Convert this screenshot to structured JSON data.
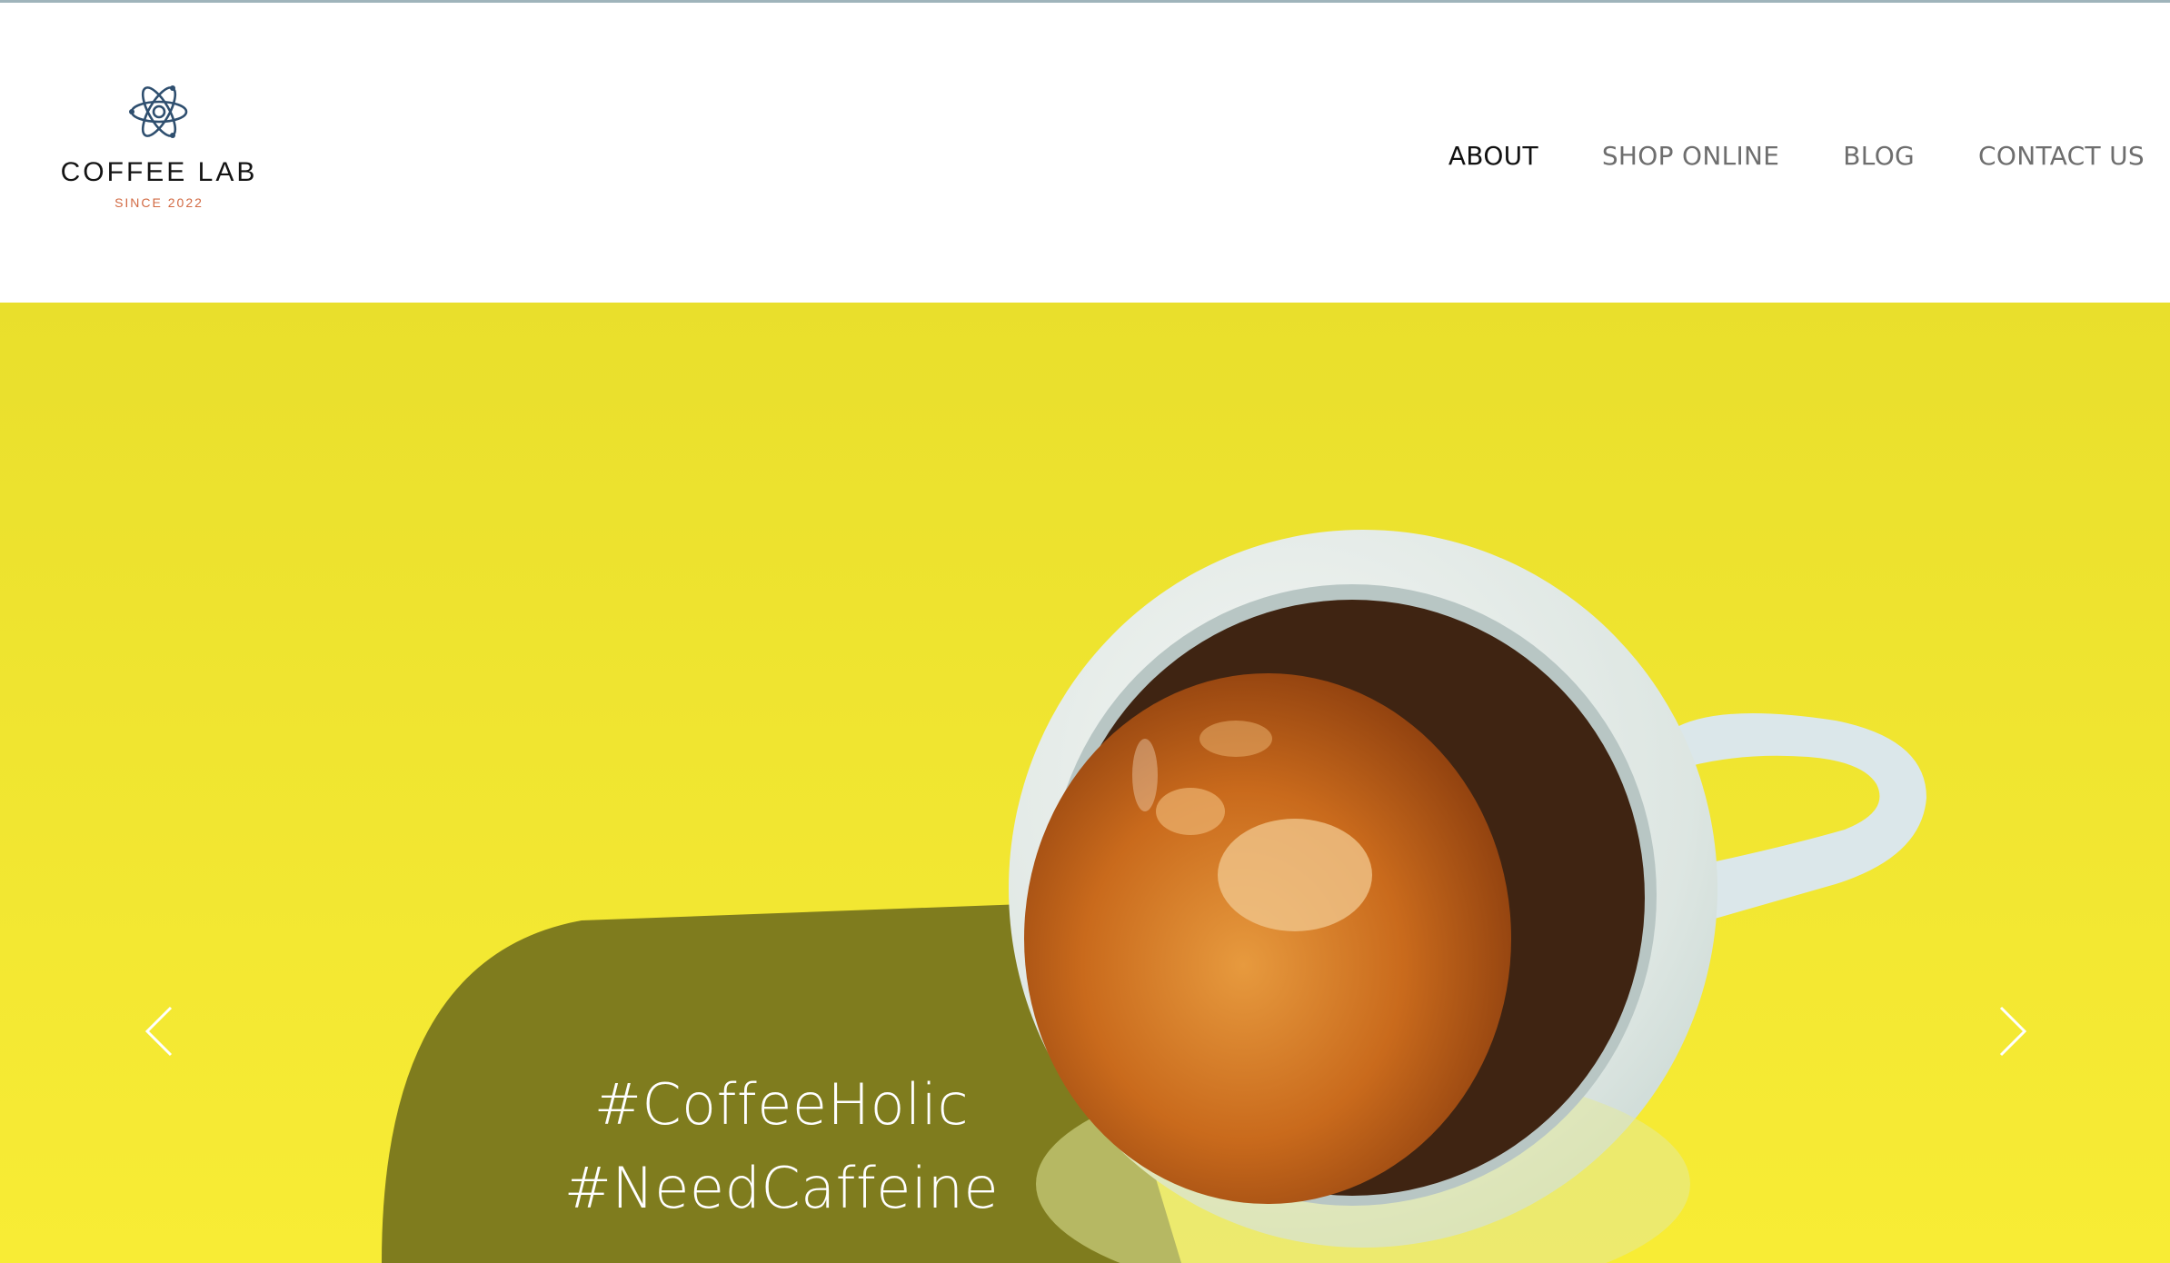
{
  "logo": {
    "brand": "COFFEE LAB",
    "tagline": "SINCE 2022",
    "icon": "atom-icon",
    "brand_color": "#141414",
    "tagline_color": "#d26a43",
    "icon_color": "#2f4f6f"
  },
  "nav": {
    "items": [
      {
        "label": "ABOUT",
        "active": true
      },
      {
        "label": "SHOP ONLINE",
        "active": false
      },
      {
        "label": "BLOG",
        "active": false
      },
      {
        "label": "CONTACT US",
        "active": false
      }
    ],
    "active_color": "#111111",
    "inactive_color": "#6e6e6e"
  },
  "hero": {
    "background_color": "#f1e42f",
    "image": "espresso-cup-on-yellow",
    "caption_line1": "#CoffeeHolic",
    "caption_line2": "#NeedCaffeine",
    "prev_icon": "chevron-left-icon",
    "next_icon": "chevron-right-icon"
  }
}
